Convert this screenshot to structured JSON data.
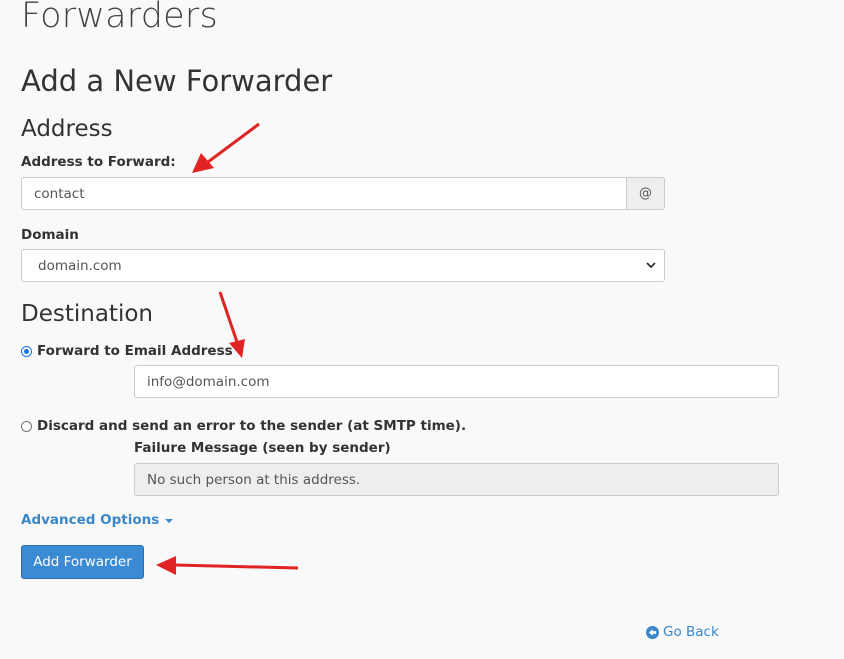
{
  "page_title": "Forwarders",
  "section_title": "Add a New Forwarder",
  "address": {
    "heading": "Address",
    "forward_label": "Address to Forward:",
    "forward_value": "contact",
    "at_symbol": "@",
    "domain_label": "Domain",
    "domain_selected": "domain.com"
  },
  "destination": {
    "heading": "Destination",
    "option_forward": "Forward to Email Address",
    "forward_email_value": "info@domain.com",
    "option_discard": "Discard and send an error to the sender (at SMTP time).",
    "failure_label": "Failure Message (seen by sender)",
    "failure_value": "No such person at this address."
  },
  "advanced_options": "Advanced Options",
  "submit_label": "Add Forwarder",
  "go_back": "Go Back",
  "colors": {
    "accent": "#3a87c8",
    "button": "#3a8ad4",
    "annotation_arrow": "#e02424"
  }
}
